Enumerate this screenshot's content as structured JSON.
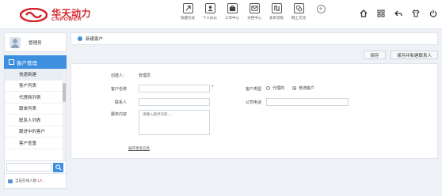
{
  "brand": {
    "name_cn": "华天动力",
    "name_en": "CNPOWER",
    "color": "#d2232a"
  },
  "topnav": [
    {
      "label": "快捷方式",
      "icon": "shortcut-icon"
    },
    {
      "label": "个人办公",
      "icon": "person-icon"
    },
    {
      "label": "工作中心",
      "icon": "briefcase-icon"
    },
    {
      "label": "文档中心",
      "icon": "document-icon"
    },
    {
      "label": "表单流程",
      "icon": "flow-icon"
    },
    {
      "label": "网上交流",
      "icon": "chat-icon"
    }
  ],
  "tools": [
    "home-icon",
    "grid-icon",
    "back-icon",
    "shirt-icon",
    "power-icon"
  ],
  "user": {
    "name": "管理员"
  },
  "menu": {
    "header": "客户管理",
    "items": [
      "快速新建",
      "客户列表",
      "代理商列表",
      "跟单列表",
      "联系人列表",
      "跟进中的客户",
      "客户查重"
    ],
    "active_index": 0
  },
  "search": {
    "placeholder": ""
  },
  "online": {
    "label": "当前在线人数",
    "count": "1人"
  },
  "accent_color": "#3d8fe0",
  "tab": {
    "label": "新建客户"
  },
  "actions": {
    "save": "保存",
    "save_new": "保存并新建联系人"
  },
  "form": {
    "creator_label": "创建人：",
    "creator_value": "管理员",
    "customer_name_label": "客户名称",
    "customer_type_label": "客户类型",
    "type_options": [
      "代理商",
      "普通客户"
    ],
    "type_selected": "普通客户",
    "contact_label": "联系人",
    "phone_label": "公司电话",
    "followup_label": "跟单内容",
    "followup_placeholder": "请输入跟单内容......",
    "more_link": "展开更多信息"
  }
}
